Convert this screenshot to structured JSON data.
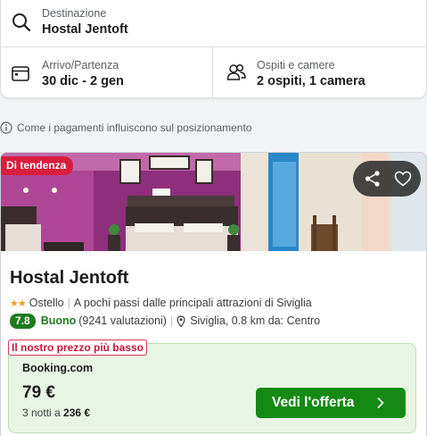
{
  "search": {
    "destination": {
      "label": "Destinazione",
      "value": "Hostal Jentoft",
      "icon": "search-icon"
    },
    "dates": {
      "label": "Arrivo/Partenza",
      "value": "30 dic - 2 gen",
      "icon": "calendar-icon"
    },
    "guests": {
      "label": "Ospiti e camere",
      "value": "2 ospiti, 1 camera",
      "icon": "people-icon"
    }
  },
  "ranking_info": {
    "text": "Come i pagamenti influiscono sul posizionamento",
    "icon": "info-icon"
  },
  "hotel": {
    "badge": "Di tendenza",
    "name": "Hostal Jentoft",
    "stars": 2,
    "type": "Ostello",
    "description": "A pochi passi dalle principali attrazioni di Siviglia",
    "score": "7.8",
    "rating_word": "Buono",
    "review_count": "(9241 valutazioni)",
    "location": "Siviglia, 0.8 km da: Centro",
    "actions": {
      "share_icon": "share-icon",
      "favorite_icon": "heart-icon"
    },
    "offer": {
      "tag": "Il nostro prezzo più basso",
      "provider": "Booking.com",
      "price": "79 €",
      "nights_prefix": "3 notti a",
      "nights_total": "236 €",
      "button_label": "Vedi l'offerta"
    }
  },
  "colors": {
    "accent_green": "#148a14",
    "badge_red": "#d91d3d",
    "score_green": "#1e7b1e",
    "star_orange": "#f29f1e"
  }
}
